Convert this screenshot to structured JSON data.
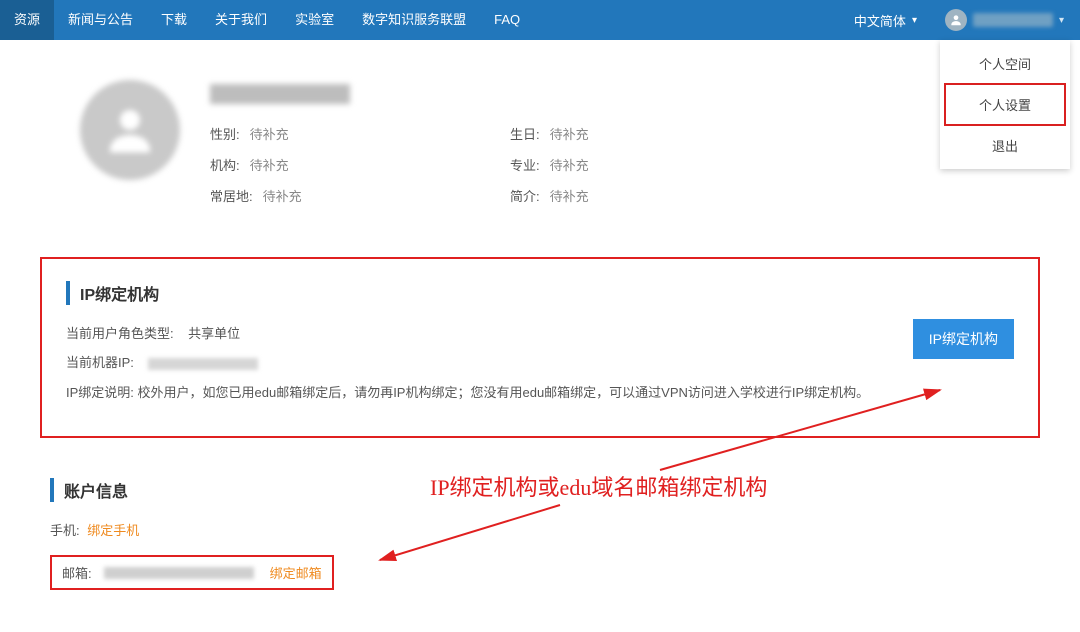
{
  "nav": {
    "items": [
      "资源",
      "新闻与公告",
      "下载",
      "关于我们",
      "实验室",
      "数字知识服务联盟",
      "FAQ"
    ],
    "lang": "中文简体"
  },
  "dropdown": {
    "space": "个人空间",
    "settings": "个人设置",
    "logout": "退出"
  },
  "profile": {
    "labels": {
      "gender": "性别:",
      "birthday": "生日:",
      "org": "机构:",
      "major": "专业:",
      "residence": "常居地:",
      "intro": "简介:"
    },
    "placeholder": "待补充"
  },
  "ip_section": {
    "title": "IP绑定机构",
    "role_label": "当前用户角色类型:",
    "role_value": "共享单位",
    "ip_label": "当前机器IP:",
    "desc": "IP绑定说明: 校外用户，如您已用edu邮箱绑定后，请勿再IP机构绑定；您没有用edu邮箱绑定，可以通过VPN访问进入学校进行IP绑定机构。",
    "button": "IP绑定机构"
  },
  "account": {
    "title": "账户信息",
    "phone_label": "手机:",
    "phone_link": "绑定手机",
    "email_label": "邮箱:",
    "email_link": "绑定邮箱"
  },
  "annotation": {
    "text": "IP绑定机构或edu域名邮箱绑定机构"
  }
}
